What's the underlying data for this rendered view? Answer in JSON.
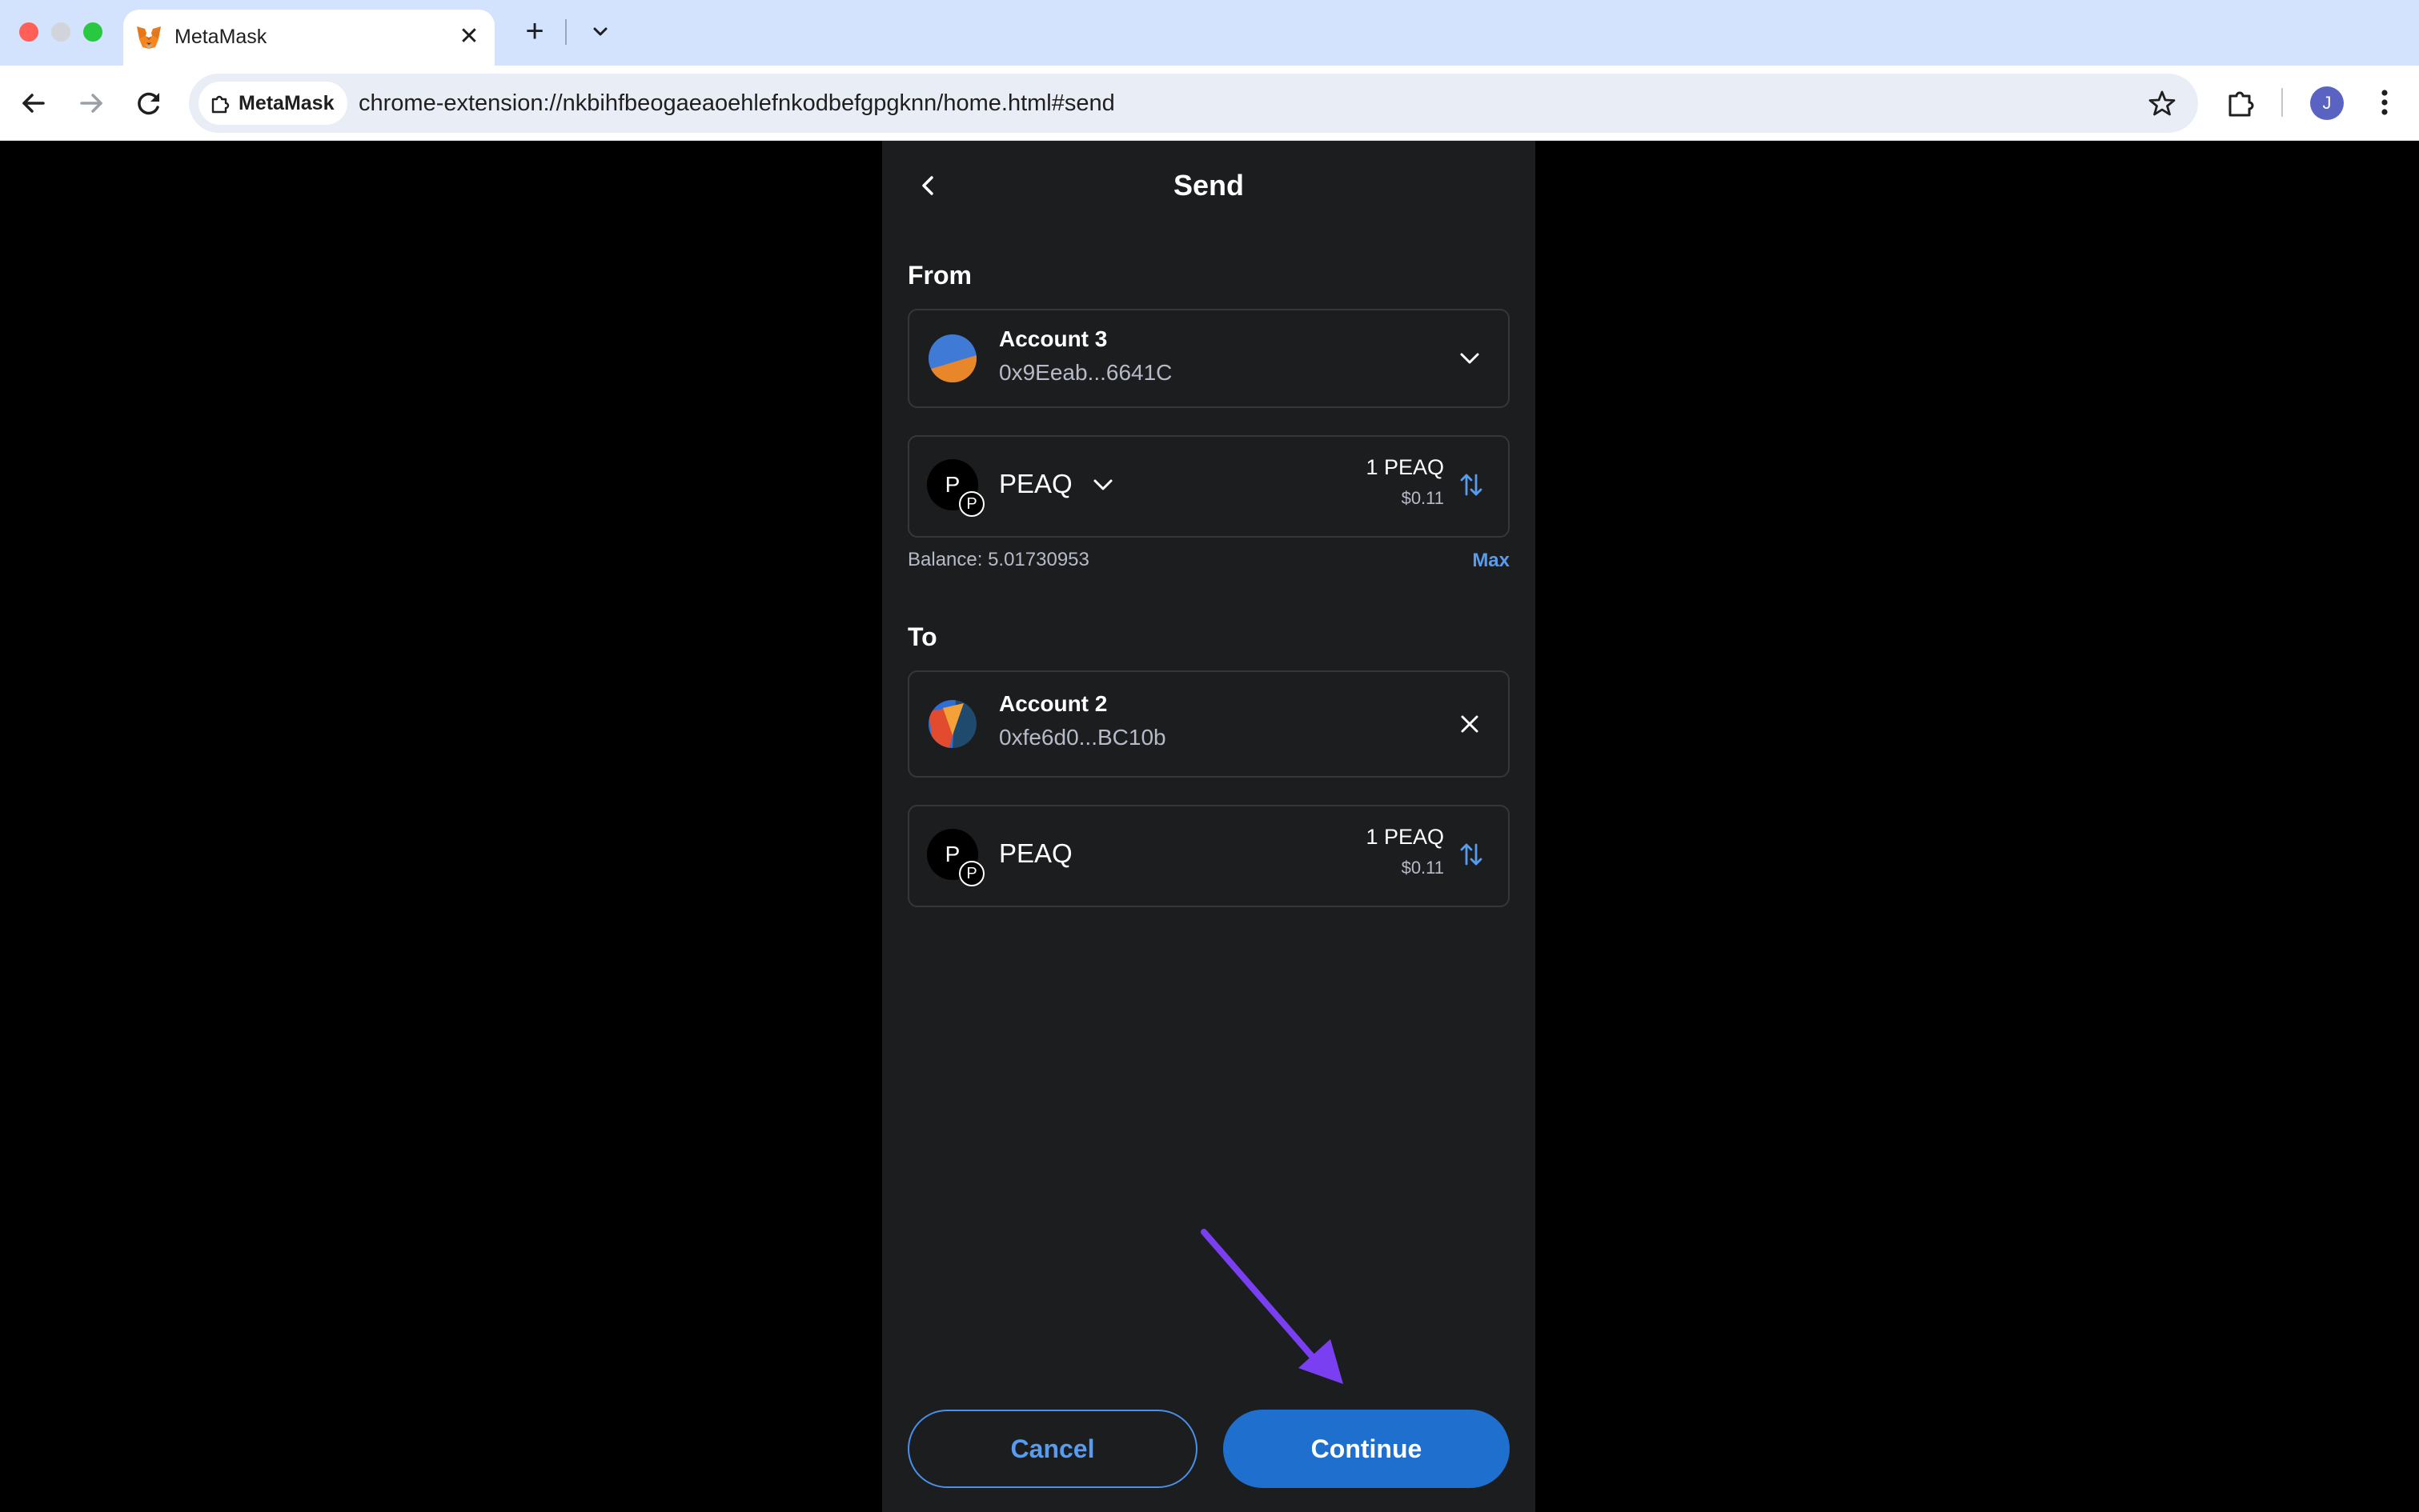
{
  "browser": {
    "tab_title": "MetaMask",
    "new_tab_glyph": "+",
    "close_glyph": "✕",
    "site_chip": "MetaMask",
    "url": "chrome-extension://nkbihfbeogaeaoehlefnkodbefgpgknn/home.html#send",
    "profile_initial": "J"
  },
  "send": {
    "title": "Send",
    "from_label": "From",
    "from_account": {
      "name": "Account 3",
      "address": "0x9Eeab...6641C"
    },
    "from_token": {
      "symbol": "PEAQ",
      "avatar_letter": "P",
      "badge_letter": "P",
      "amount": "1 PEAQ",
      "fiat": "$0.11"
    },
    "balance": "Balance: 5.01730953",
    "max_label": "Max",
    "to_label": "To",
    "to_account": {
      "name": "Account 2",
      "address": "0xfe6d0...BC10b"
    },
    "to_token": {
      "symbol": "PEAQ",
      "avatar_letter": "P",
      "badge_letter": "P",
      "amount": "1 PEAQ",
      "fiat": "$0.11"
    },
    "cancel_label": "Cancel",
    "continue_label": "Continue"
  },
  "colors": {
    "panel_bg": "#1c1d1f",
    "accent_blue": "#1f6fce",
    "link_blue": "#589cf0",
    "annotation_arrow": "#7b3ff2",
    "tabbar_bg": "#d3e3fd"
  },
  "icons": {
    "favicon": "metamask-fox-icon",
    "back": "arrow-left-icon",
    "forward": "arrow-right-icon",
    "reload": "reload-icon",
    "star": "star-icon",
    "extensions": "puzzle-icon",
    "menu": "kebab-menu-icon",
    "from_dropdown": "chevron-down-icon",
    "to_clear": "close-icon",
    "swap": "swap-vertical-icon"
  }
}
